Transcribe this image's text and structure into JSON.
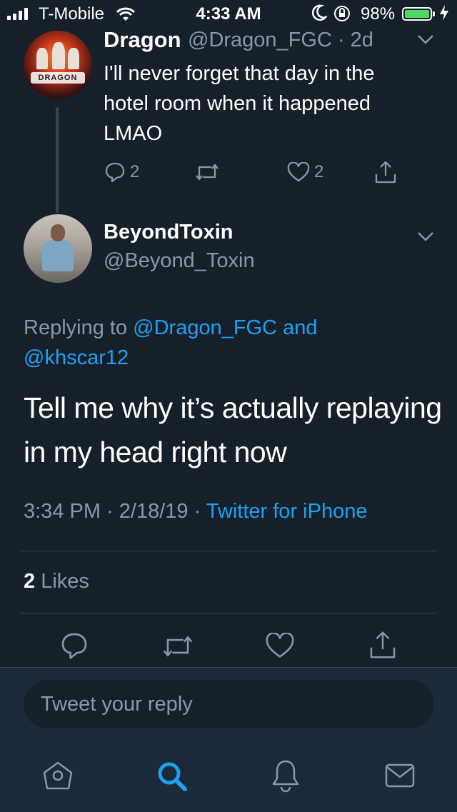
{
  "status_bar": {
    "carrier": "T-Mobile",
    "time": "4:33 AM",
    "battery": "98%"
  },
  "parent_tweet": {
    "name": "Dragon",
    "handle_time": "@Dragon_FGC · 2d",
    "avatar_text": "DRAGON",
    "text": "I'll never forget that day in the hotel room when it happened LMAO",
    "reply_count": "2",
    "like_count": "2"
  },
  "main_tweet": {
    "name": "BeyondToxin",
    "handle": "@Beyond_Toxin",
    "replying_prefix": "Replying to",
    "replying_user1": "@Dragon_FGC",
    "replying_and": "and",
    "replying_user2": "@khscar12",
    "text": "Tell me why it’s actually replaying in my head right now",
    "timestamp": "3:34 PM · 2/18/19 ·",
    "source": "Twitter for iPhone",
    "likes_count": "2",
    "likes_label": "Likes"
  },
  "reply_box": {
    "placeholder": "Tweet your reply"
  },
  "icons": {
    "reply": "reply-icon",
    "retweet": "retweet-icon",
    "like": "heart-icon",
    "share": "share-icon",
    "home": "home-icon",
    "search": "search-icon",
    "notifications": "bell-icon",
    "messages": "mail-icon"
  },
  "colors": {
    "background": "#15202b",
    "accent": "#1da1f2",
    "muted": "#8899a6",
    "divider": "#38444d",
    "battery": "#4cd964"
  }
}
